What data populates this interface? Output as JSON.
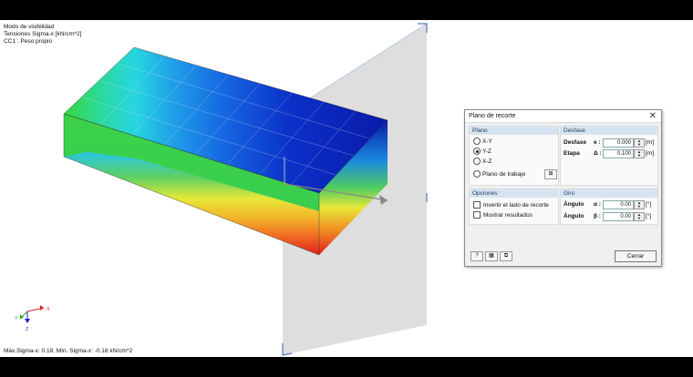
{
  "viewport": {
    "info_lines": [
      "Modo de visibilidad",
      "Tensiones Sigma-x [kN/cm^2]",
      "CC1 : Peso propio"
    ],
    "footer": "Máx.Sigma-x: 0.18, Mín. Sigma-x: -0.18 kN/cm^2",
    "axes": {
      "x": "X",
      "y": "Y",
      "z": "Z"
    }
  },
  "dialog": {
    "title": "Plano de recorte",
    "plano": {
      "header": "Plano",
      "options": [
        "X-Y",
        "Y-Z",
        "X-Z"
      ],
      "selected": "Y-Z",
      "work_plane_label": "Plano de trabajo"
    },
    "desfase": {
      "header": "Desfase",
      "rows": [
        {
          "label": "Desfase",
          "symbol": "e :",
          "value": "0.000",
          "unit": "[m]"
        },
        {
          "label": "Etapa",
          "symbol": "Δ :",
          "value": "0.100",
          "unit": "[m]"
        }
      ]
    },
    "opciones": {
      "header": "Opciones",
      "checks": [
        "Invertir el lado de recorte",
        "Mostrar resultados"
      ]
    },
    "giro": {
      "header": "Giro",
      "rows": [
        {
          "label": "Ángulo",
          "symbol": "α :",
          "value": "0.00",
          "unit": "[°]"
        },
        {
          "label": "Ángulo",
          "symbol": "β :",
          "value": "0.00",
          "unit": "[°]"
        }
      ]
    },
    "close_label": "Cerrar"
  }
}
